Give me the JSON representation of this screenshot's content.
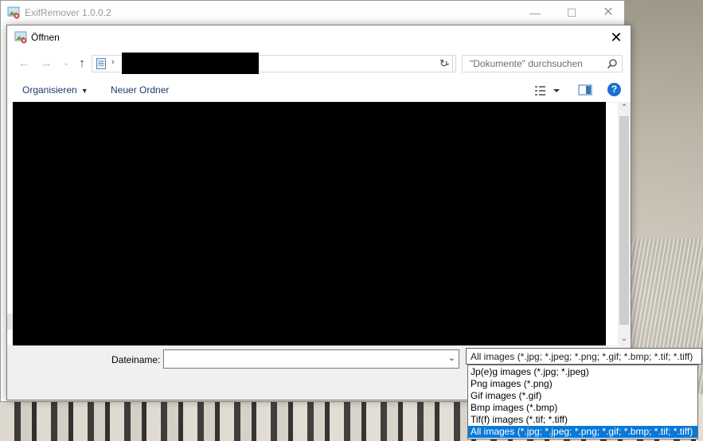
{
  "main_window": {
    "title": "ExifRemover 1.0.0.2",
    "minimize": "—",
    "maximize": "☐",
    "close": "✕"
  },
  "dialog": {
    "title": "Öffnen",
    "close": "✕"
  },
  "nav": {
    "back": "←",
    "forward": "→",
    "recent": "⌄",
    "up": "↑",
    "address_sep": "›",
    "address_dropdown": "⌄",
    "refresh": "↻",
    "search_placeholder": "\"Dokumente\" durchsuchen"
  },
  "toolbar": {
    "organize": "Organisieren",
    "organize_caret": "▼",
    "new_folder": "Neuer Ordner",
    "help": "?"
  },
  "scrollbar": {
    "up": "⌃",
    "down": "⌄"
  },
  "file_name": {
    "label": "Dateiname:",
    "value": "",
    "dropdown": "⌄"
  },
  "file_type": {
    "selected": "All images (*.jpg; *.jpeg; *.png; *.gif; *.bmp; *.tif; *.tiff)",
    "options": [
      "Jp(e)g images (*.jpg; *.jpeg)",
      "Png images (*.png)",
      "Gif images (*.gif)",
      "Bmp images (*.bmp)",
      "Tif(f) images (*.tif; *.tiff)",
      "All images (*.jpg; *.jpeg; *.png; *.gif; *.bmp; *.tif; *.tiff)"
    ],
    "highlighted_index": 5
  },
  "colors": {
    "accent": "#0a78d7",
    "link": "#1e3a6e",
    "help_icon": "#1a6fd1"
  },
  "icons": {
    "app": "exifremover-app-icon",
    "dialog": "open-dialog-icon",
    "address": "document-folder-icon",
    "search": "search-icon",
    "view": "view-options-icon",
    "pane": "preview-pane-icon"
  }
}
